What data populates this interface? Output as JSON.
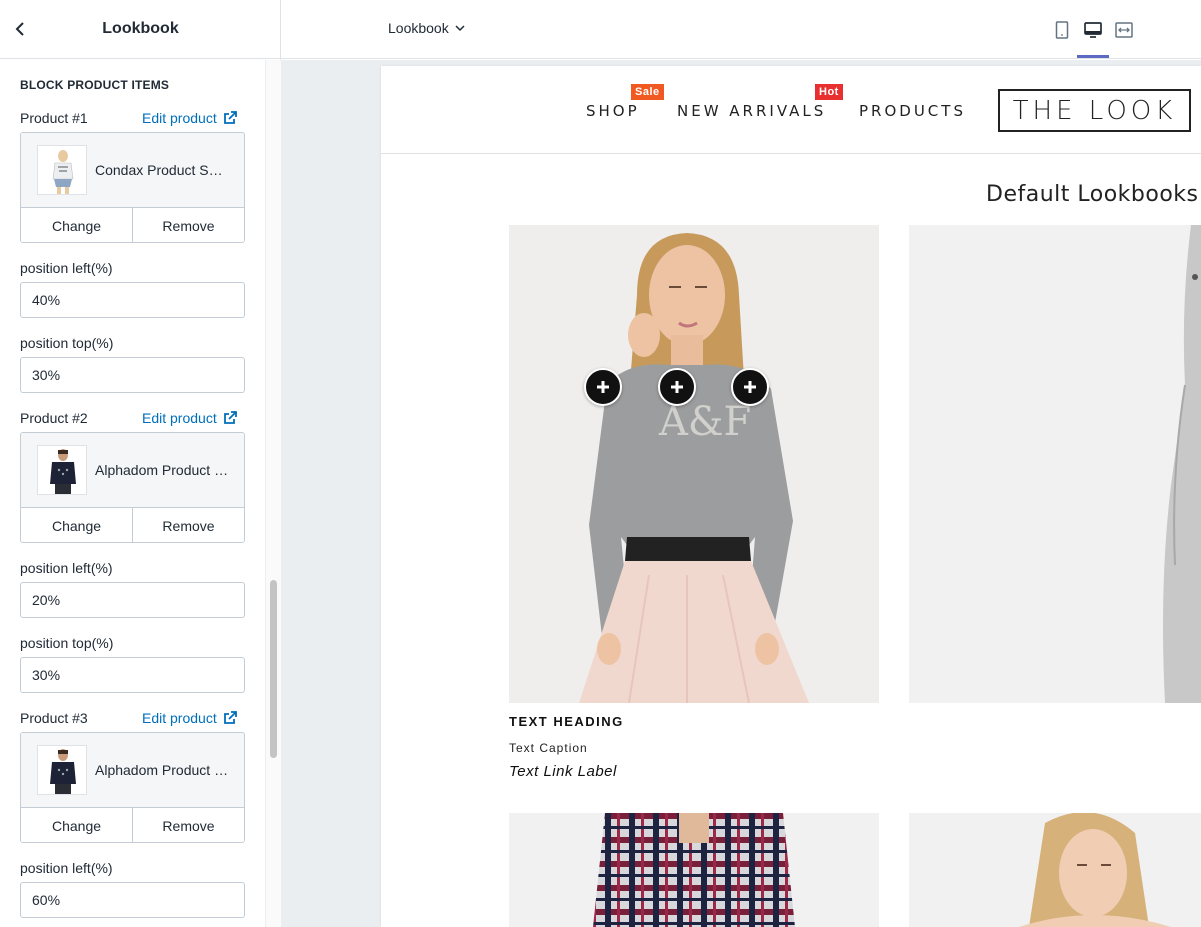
{
  "sidebar": {
    "title": "Lookbook",
    "section_title": "BLOCK PRODUCT ITEMS",
    "edit_label": "Edit product",
    "change_label": "Change",
    "remove_label": "Remove",
    "products": [
      {
        "label": "Product #1",
        "name": "Condax Product Sample",
        "fields": [
          {
            "label": "position left(%)",
            "value": "40%"
          },
          {
            "label": "position top(%)",
            "value": "30%"
          }
        ]
      },
      {
        "label": "Product #2",
        "name": "Alphadom Product Sample",
        "fields": [
          {
            "label": "position left(%)",
            "value": "20%"
          },
          {
            "label": "position top(%)",
            "value": "30%"
          }
        ]
      },
      {
        "label": "Product #3",
        "name": "Alphadom Product Sample",
        "fields": [
          {
            "label": "position left(%)",
            "value": "60%"
          }
        ]
      }
    ]
  },
  "topbar": {
    "page_select": "Lookbook",
    "views": [
      "mobile-view-icon",
      "desktop-view-icon",
      "full-width-view-icon"
    ],
    "active_view": "desktop-view-icon"
  },
  "preview": {
    "nav": [
      {
        "label": "SHOP",
        "badge": "Sale"
      },
      {
        "label": "NEW ARRIVALS",
        "badge": "Hot"
      },
      {
        "label": "PRODUCTS",
        "badge": ""
      }
    ],
    "logo_text": "THE LOOK",
    "section_title": "Default Lookbooks",
    "lookbook_item": {
      "heading": "TEXT HEADING",
      "caption": "Text Caption",
      "link": "Text Link Label"
    },
    "colors": {
      "accent": "#5c6ac4",
      "link": "#006fbb",
      "sale_badge": "#f05a22",
      "hot_badge": "#e83030"
    }
  }
}
